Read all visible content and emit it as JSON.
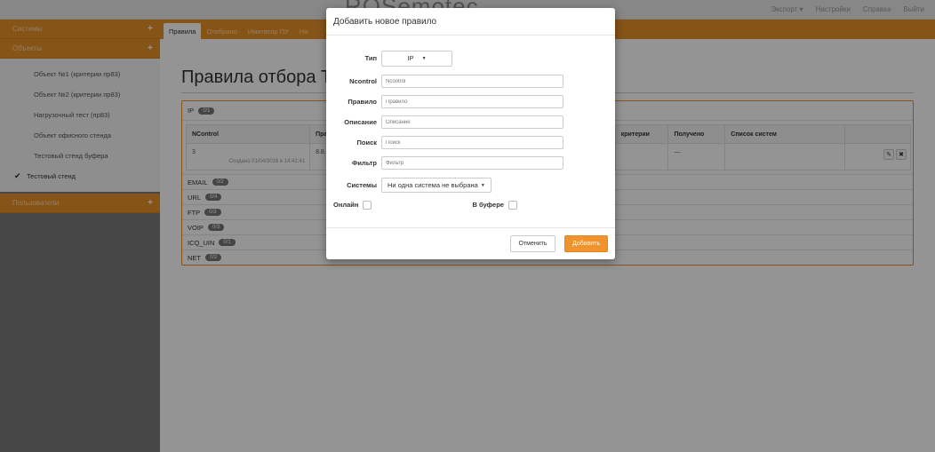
{
  "topbar": {
    "brand": "ROSemotec",
    "nav": [
      "Экспорт ▾",
      "Настройки",
      "Справка",
      "Выйти"
    ]
  },
  "sidebar": {
    "systems_label": "Системы",
    "objects_label": "Объекты",
    "items": [
      {
        "label": "Объект №1 (критерии пр83)",
        "active": false
      },
      {
        "label": "Объект №2 (критерии пр83)",
        "active": false
      },
      {
        "label": "Нагрузочный тест (пр83)",
        "active": false
      },
      {
        "label": "Объект офисного стенда",
        "active": false
      },
      {
        "label": "Тестовый стенд буфера",
        "active": false
      },
      {
        "label": "Тестовый стенд",
        "active": true
      }
    ],
    "users_label": "Пользователи",
    "plus": "+"
  },
  "tabs": [
    "Правила",
    "Отобрано",
    "Имитатор ПУ",
    "На"
  ],
  "page": {
    "title": "Правила отбора Т",
    "ip_group": {
      "label": "IP",
      "badge": "0/1"
    },
    "table": {
      "headers": [
        "NControl",
        "Прав",
        "",
        "критерии",
        "Получено",
        "Список систем",
        ""
      ],
      "row": {
        "ncontrol": "3",
        "created": "Создано 01/04/2016 в 14:41:41",
        "rule": "8.8.8",
        "received": "—"
      }
    },
    "groups": [
      {
        "label": "EMAIL",
        "badge": "0/2"
      },
      {
        "label": "URL",
        "badge": "0/4"
      },
      {
        "label": "FTP",
        "badge": "0/3"
      },
      {
        "label": "VOIP",
        "badge": "0/3"
      },
      {
        "label": "ICQ_UIN",
        "badge": "0/1"
      },
      {
        "label": "NET",
        "badge": "0/2"
      }
    ]
  },
  "modal": {
    "title": "Добавить новое правило",
    "type_label": "Тип",
    "type_value": "IP",
    "ncontrol_label": "Ncontrol",
    "ncontrol_placeholder": "Ncontrol",
    "rule_label": "Правило",
    "rule_placeholder": "Правило",
    "desc_label": "Описание",
    "desc_placeholder": "Описание",
    "search_label": "Поиск",
    "search_placeholder": "Поиск",
    "filter_label": "Фильтр",
    "filter_placeholder": "Фильтр",
    "systems_label": "Системы",
    "systems_value": "Ни одна система не выбрана",
    "online_label": "Онлайн",
    "buffer_label": "В буфере",
    "cancel_label": "Отменить",
    "add_label": "Добавить"
  },
  "colors": {
    "accent": "#e8922a",
    "sidebar_bg": "#7a7a7a",
    "badge": "#777777"
  }
}
